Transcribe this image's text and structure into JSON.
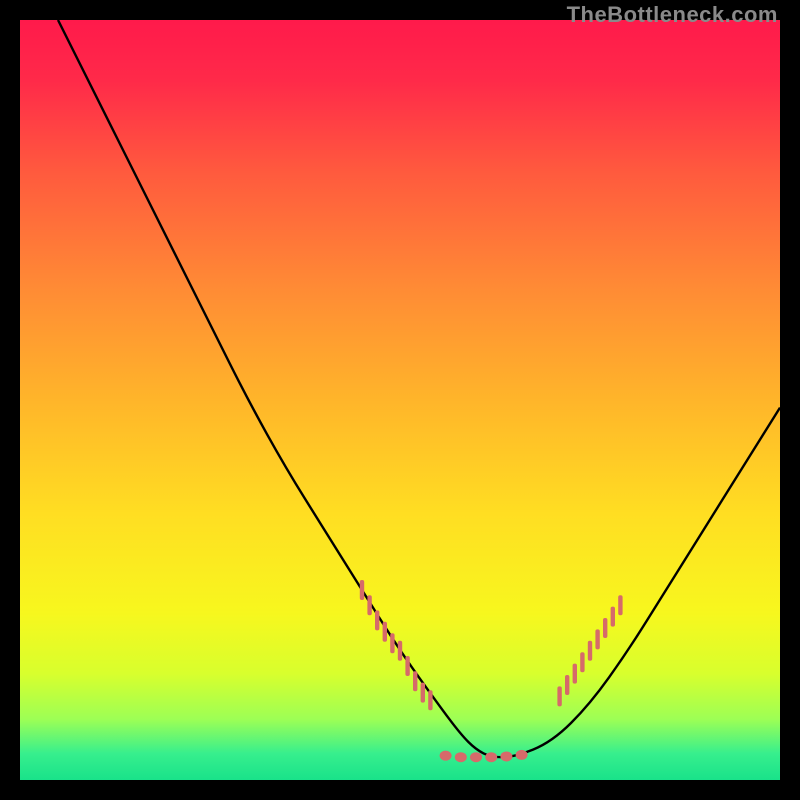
{
  "watermark": "TheBottleneck.com",
  "chart_data": {
    "type": "line",
    "title": "",
    "xlabel": "",
    "ylabel": "",
    "xlim": [
      0,
      100
    ],
    "ylim": [
      0,
      100
    ],
    "background_gradient": {
      "stops": [
        {
          "pos": 0.0,
          "color": "#ff1a4b"
        },
        {
          "pos": 0.08,
          "color": "#ff2a49"
        },
        {
          "pos": 0.2,
          "color": "#ff5a3e"
        },
        {
          "pos": 0.35,
          "color": "#ff8a35"
        },
        {
          "pos": 0.5,
          "color": "#ffb52a"
        },
        {
          "pos": 0.65,
          "color": "#ffde22"
        },
        {
          "pos": 0.78,
          "color": "#f7f71e"
        },
        {
          "pos": 0.86,
          "color": "#d8ff2d"
        },
        {
          "pos": 0.92,
          "color": "#9dff55"
        },
        {
          "pos": 0.965,
          "color": "#37ef8d"
        },
        {
          "pos": 1.0,
          "color": "#19e28a"
        }
      ]
    },
    "series": [
      {
        "name": "bottleneck-curve",
        "color": "#000000",
        "x": [
          5,
          10,
          15,
          20,
          25,
          30,
          35,
          40,
          45,
          50,
          55,
          58,
          60,
          62,
          65,
          70,
          75,
          80,
          85,
          90,
          95,
          100
        ],
        "y": [
          100,
          90,
          80,
          70,
          60,
          50,
          41,
          33,
          25,
          17,
          10,
          6,
          4,
          3,
          3,
          5,
          10,
          17,
          25,
          33,
          41,
          49
        ]
      }
    ],
    "markers": {
      "name": "highlighted-range",
      "color": "#d66a6a",
      "description": "Dense salmon tick/dot markers along the curve near the valley (left and right flanks) plus flat dots at the minimum.",
      "points": [
        {
          "x": 45,
          "y": 25
        },
        {
          "x": 46,
          "y": 23
        },
        {
          "x": 47,
          "y": 21
        },
        {
          "x": 48,
          "y": 19.5
        },
        {
          "x": 49,
          "y": 18
        },
        {
          "x": 50,
          "y": 17
        },
        {
          "x": 51,
          "y": 15
        },
        {
          "x": 52,
          "y": 13
        },
        {
          "x": 53,
          "y": 11.5
        },
        {
          "x": 54,
          "y": 10.5
        },
        {
          "x": 56,
          "y": 3.2
        },
        {
          "x": 58,
          "y": 3.0
        },
        {
          "x": 60,
          "y": 3.0
        },
        {
          "x": 62,
          "y": 3.0
        },
        {
          "x": 64,
          "y": 3.1
        },
        {
          "x": 66,
          "y": 3.3
        },
        {
          "x": 71,
          "y": 11
        },
        {
          "x": 72,
          "y": 12.5
        },
        {
          "x": 73,
          "y": 14
        },
        {
          "x": 74,
          "y": 15.5
        },
        {
          "x": 75,
          "y": 17
        },
        {
          "x": 76,
          "y": 18.5
        },
        {
          "x": 77,
          "y": 20
        },
        {
          "x": 78,
          "y": 21.5
        },
        {
          "x": 79,
          "y": 23
        }
      ]
    }
  }
}
